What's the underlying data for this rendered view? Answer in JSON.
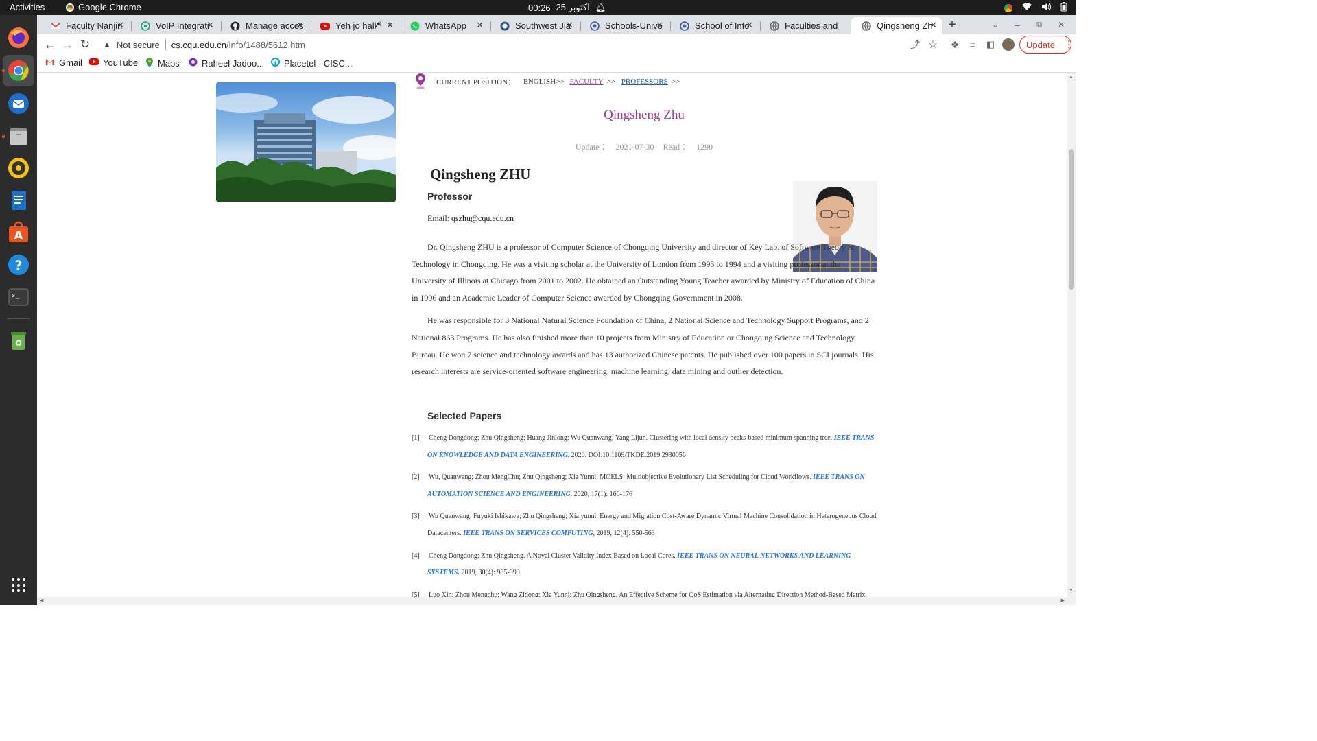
{
  "system_bar": {
    "activities": "Activities",
    "app_name": "Google Chrome",
    "clock_time": "00:26",
    "clock_date": "25 اکتوبر"
  },
  "dock": {
    "items": [
      "firefox-icon",
      "chrome-icon",
      "thunderbird-icon",
      "files-icon",
      "rhythmbox-icon",
      "writer-icon",
      "software-icon",
      "help-icon",
      "terminal-icon",
      "trash-icon",
      "app-grid-icon"
    ]
  },
  "tabs": [
    {
      "title": "Faculty Nanjin",
      "favicon_color": "#ea4335"
    },
    {
      "title": "VoIP Integrati",
      "favicon_color": "#10a37f"
    },
    {
      "title": "Manage acces",
      "favicon_color": "#24292f"
    },
    {
      "title": "Yeh jo halk",
      "favicon_color": "#ff0000"
    },
    {
      "title": "WhatsApp",
      "favicon_color": "#25d366"
    },
    {
      "title": "Southwest Jia",
      "favicon_color": "#2b5797"
    },
    {
      "title": "Schools-Unive",
      "favicon_color": "#3b5ba5"
    },
    {
      "title": "School of Info",
      "favicon_color": "#3b5ba5"
    },
    {
      "title": "Faculties and",
      "favicon_color": "#5f6368"
    },
    {
      "title": "Qingsheng Zh",
      "favicon_color": "#5f6368"
    }
  ],
  "toolbar": {
    "security_label": "Not secure",
    "url_host": "cs.cqu.edu.cn",
    "url_path": "/info/1488/5612.htm",
    "update_label": "Update"
  },
  "bookmarks": [
    {
      "label": "Gmail",
      "color": "#ea4335"
    },
    {
      "label": "YouTube",
      "color": "#ff0000"
    },
    {
      "label": "Maps",
      "color": "#34a853"
    },
    {
      "label": "Raheel Jadoo...",
      "color": "#7b2cbf"
    },
    {
      "label": "Placetel - CISC...",
      "color": "#00a3e0"
    }
  ],
  "page": {
    "breadcrumb": {
      "label": "CURRENT POSITION：",
      "home": "ENGLISH>>",
      "faculty": "FACULTY",
      "sep1": ">>",
      "professors": "PROFESSORS",
      "sep2": ">>"
    },
    "title": "Qingsheng Zhu",
    "meta": {
      "update_label": "Update ：",
      "update_date": "2021-07-30",
      "read_label": "Read ：",
      "read_count": "1290"
    },
    "name_heading": "Qingsheng ZHU",
    "position": "Professor",
    "email_label": "Email:",
    "email": "qszhu@cqu.edu.cn",
    "bio_paragraphs": [
      "Dr. Qingsheng ZHU is a professor of Computer Science of Chongqing University and director of Key Lab. of Software Theory & Technology in Chongqing. He was a visiting scholar at the University of London from 1993 to 1994 and a visiting professor at the University of Illinois at Chicago from 2001 to 2002. He obtained an Outstanding Young Teacher awarded by Ministry of Education of China in 1996 and an Academic Leader of Computer Science awarded by Chongqing Government in 2008.",
      "He was responsible for 3 National Natural Science Foundation of China, 2 National Science and Technology Support Programs, and 2 National 863 Programs. He has also finished more than 10 projects from Ministry of Education or Chongqing Science and Technology Bureau. He won 7 science and technology awards and has 13 authorized Chinese patents. He published over 100 papers in SCI journals. His research interests are service-oriented software engineering, machine learning, data mining and outlier detection."
    ],
    "papers_heading": "Selected Papers",
    "papers": [
      {
        "num": "[1]",
        "text": "Cheng Dongdong; Zhu Qingsheng; Huang Jinlong; Wu Quanwang; Yang Lijun. Clustering with local density peaks-based minimum spanning tree.",
        "journal": "IEEE TRANS ON KNOWLEDGE AND DATA ENGINEERING.",
        "tail": "2020. DOI:10.1109/TKDE.2019.2930056"
      },
      {
        "num": "[2]",
        "text": "Wu, Quanwang; Zhou MengChu; Zhu Qingsheng; Xia Yunni. MOELS: Multiobjective Evolutionary List Scheduling for Cloud Workflows.",
        "journal": "IEEE TRANS ON AUTOMATION SCIENCE AND ENGINEERING",
        "tail": ". 2020, 17(1): 166-176"
      },
      {
        "num": "[3]",
        "text": "Wu Quanwang; Fuyuki Ishikawa; Zhu Qingsheng; Xia yunni. Energy and Migration Cost-Aware Dynamic Virtual Machine Consolidation in Heterogeneous Cloud Datacenters.",
        "journal": "IEEE TRANS ON SERVICES COMPUTING",
        "tail": ", 2019, 12(4): 550-563"
      },
      {
        "num": "[4]",
        "text": "Cheng Dongdong; Zhu Qingsheng. A Novel Cluster Validity Index Based on Local Cores.",
        "journal": "IEEE TRANS ON NEURAL NETWORKS AND LEARNING SYSTEMS.",
        "tail": "2019, 30(4): 985-999"
      },
      {
        "num": "[5]",
        "text": "Luo Xin; Zhou Mengchu; Wang Zidong; Xia Yunni; Zhu Qingsheng. An Effective Scheme for QoS Estimation via Alternating Direction Method-Based Matrix",
        "journal": "",
        "tail": ""
      }
    ]
  }
}
